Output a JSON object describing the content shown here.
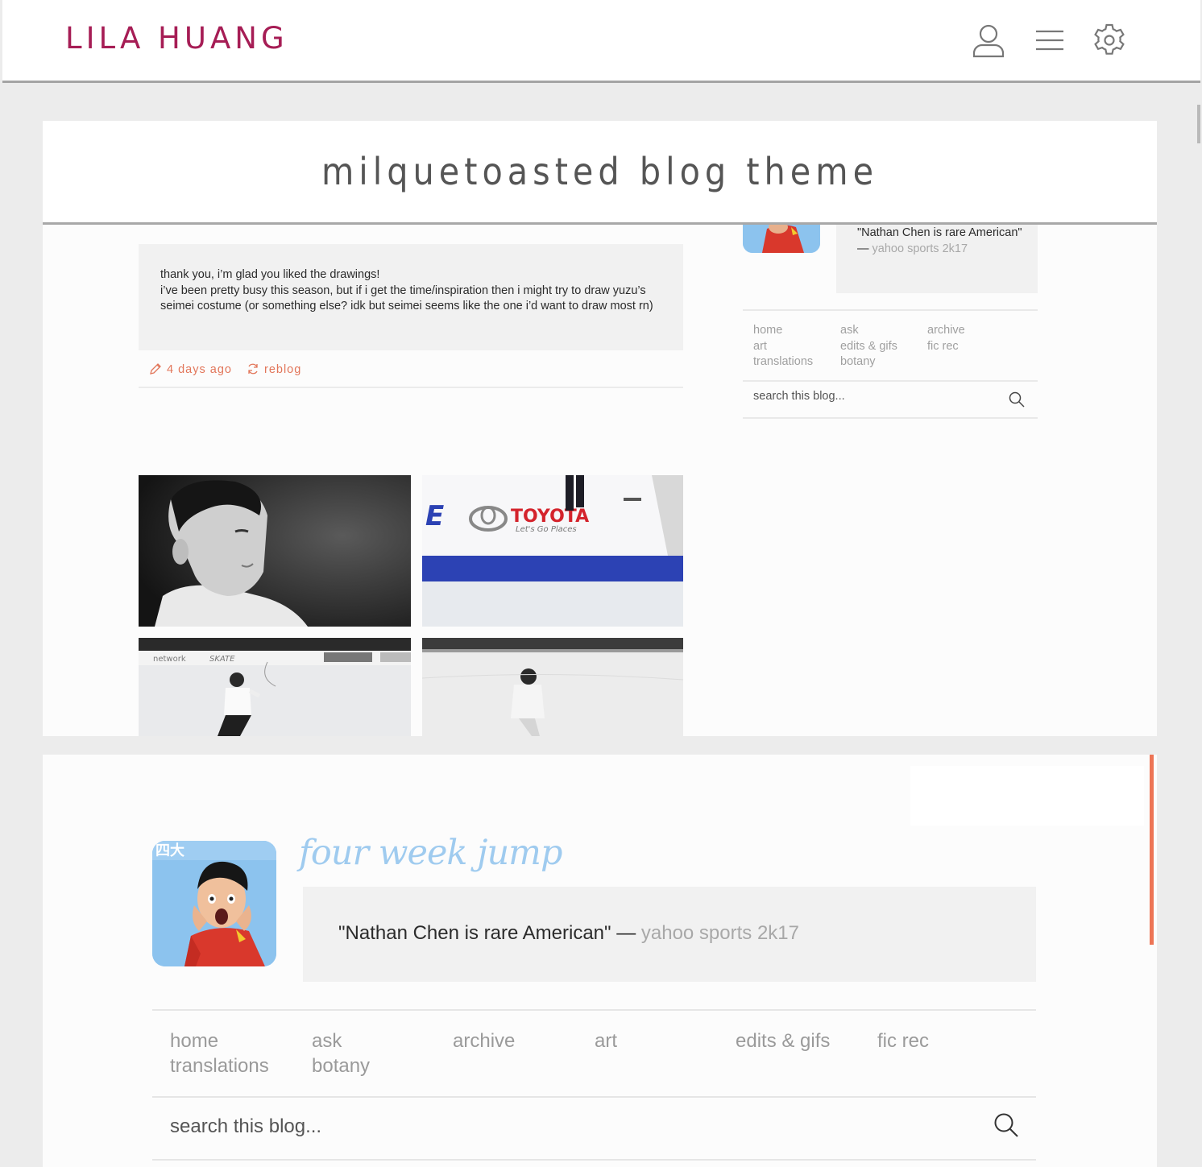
{
  "header": {
    "brand": "LILA HUANG",
    "icons": [
      "user-icon",
      "menu-icon",
      "settings-icon"
    ]
  },
  "panel1": {
    "title": "milquetoasted blog theme",
    "post": {
      "lines": [
        "thank you, i’m glad you liked the drawings!",
        "i’ve been pretty busy this season, but if i get the time/inspiration then i might try to draw yuzu’s seimei costume (or something else? idk but seimei seems like the one i’d want to draw most rn)"
      ],
      "time": "4 days ago",
      "reblog": "reblog"
    },
    "photos": {
      "sign_brand": "TOYOTA",
      "sign_slogan": "Let's Go Places",
      "board_text_left": "network",
      "board_text_right": "SKATE"
    },
    "sidebar": {
      "quote": "\"Nathan Chen is rare American\" —",
      "quote_source": "yahoo sports 2k17",
      "nav": [
        [
          "home",
          "art",
          "translations"
        ],
        [
          "ask",
          "edits & gifs",
          "botany"
        ],
        [
          "archive",
          "fic rec"
        ]
      ],
      "search_placeholder": "search this blog..."
    }
  },
  "panel2": {
    "blog_name": "four week jump",
    "quote": "\"Nathan Chen is rare American\" —",
    "quote_source": "yahoo sports 2k17",
    "nav": [
      [
        "home",
        "translations"
      ],
      [
        "ask",
        "botany"
      ],
      [
        "archive"
      ],
      [
        "art"
      ],
      [
        "edits & gifs"
      ],
      [
        "fic rec"
      ]
    ],
    "search_placeholder": "search this blog..."
  },
  "colors": {
    "brand": "#a61d55",
    "accent": "#e2765a",
    "blog_name": "#9fcbef"
  }
}
